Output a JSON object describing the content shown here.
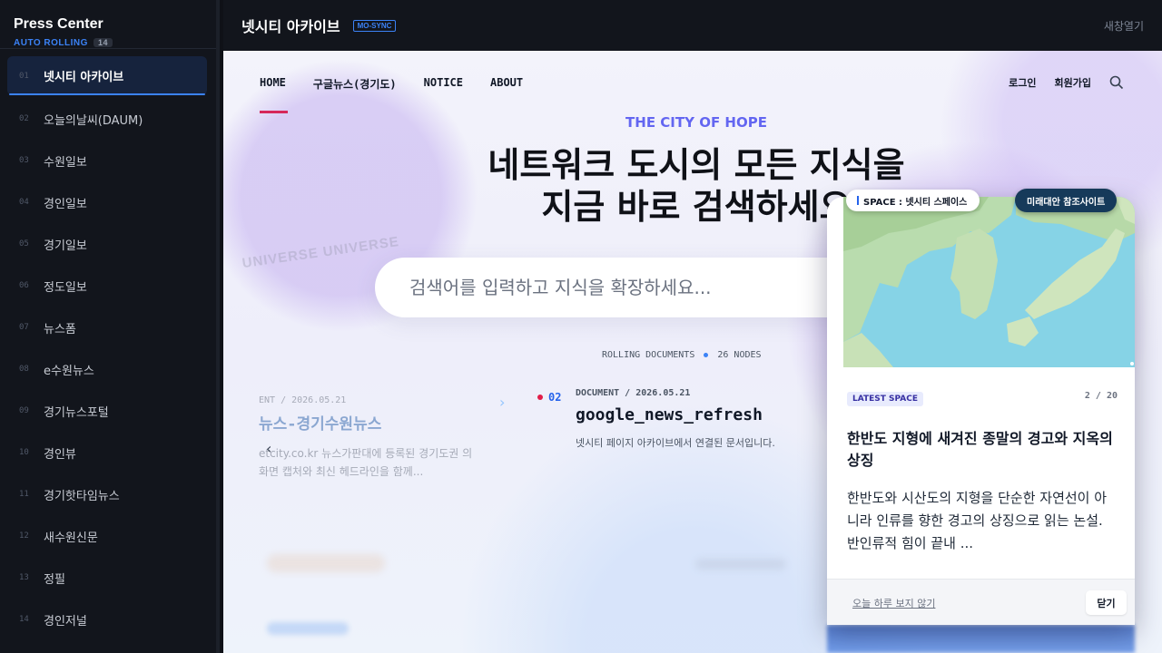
{
  "sidebar": {
    "title": "Press Center",
    "subtitle": "AUTO ROLLING",
    "count": "14",
    "items": [
      {
        "num": "01",
        "label": "넷시티 아카이브"
      },
      {
        "num": "02",
        "label": "오늘의날씨(DAUM)"
      },
      {
        "num": "03",
        "label": "수원일보"
      },
      {
        "num": "04",
        "label": "경인일보"
      },
      {
        "num": "05",
        "label": "경기일보"
      },
      {
        "num": "06",
        "label": "정도일보"
      },
      {
        "num": "07",
        "label": "뉴스폼"
      },
      {
        "num": "08",
        "label": "e수원뉴스"
      },
      {
        "num": "09",
        "label": "경기뉴스포털"
      },
      {
        "num": "10",
        "label": "경인뷰"
      },
      {
        "num": "11",
        "label": "경기핫타임뉴스"
      },
      {
        "num": "12",
        "label": "새수원신문"
      },
      {
        "num": "13",
        "label": "정필"
      },
      {
        "num": "14",
        "label": "경인저널"
      }
    ]
  },
  "topbar": {
    "title": "넷시티 아카이브",
    "badge": "MO-SYNC",
    "new_window": "새창열기"
  },
  "nav": {
    "items": [
      "HOME",
      "구글뉴스(경기도)",
      "NOTICE",
      "ABOUT"
    ],
    "login": "로그인",
    "signup": "회원가입"
  },
  "hero": {
    "kicker": "THE CITY OF HOPE",
    "headline_line1": "네트워크 도시의 모든 지식을",
    "headline_line2": "지금 바로 검색하세요",
    "watermark": "UNIVERSE   UNIVERSE",
    "search_placeholder": "검색어를 입력하고 지식을 확장하세요..."
  },
  "rolling": {
    "label": "ROLLING DOCUMENTS",
    "nodes": "26 NODES"
  },
  "doc_prev": {
    "meta": "ENT / 2026.05.21",
    "title": "뉴스-경기수원뉴스",
    "desc": "etcity.co.kr 뉴스가판대에 등록된 경기도권 의 화면 캡처와 최신 헤드라인을 함께..."
  },
  "doc_current": {
    "index": "02",
    "meta": "DOCUMENT / 2026.05.21",
    "title": "google_news_refresh",
    "desc": "넷시티 페이지 아카이브에서 연결된 문서입니다."
  },
  "popup": {
    "chip": "SPACE : 넷시티 스페이스",
    "link": "미래대안 참조사이트",
    "tag": "LATEST SPACE",
    "page": "2 / 20",
    "title": "한반도 지형에 새겨진 종말의 경고와 지옥의 상징",
    "desc": "한반도와 시산도의 지형을 단순한 자연선이 아니라 인류를 향한 경고의 상징으로 읽는 논설. 반인류적 힘이 끝내 ...",
    "skip": "오늘 하루 보지 않기",
    "close": "닫기"
  },
  "colors": {
    "accent": "#3b82f6",
    "nav_underline": "#d6285a",
    "kicker": "#6366f1",
    "popup_link_bg": "#163a5a"
  }
}
